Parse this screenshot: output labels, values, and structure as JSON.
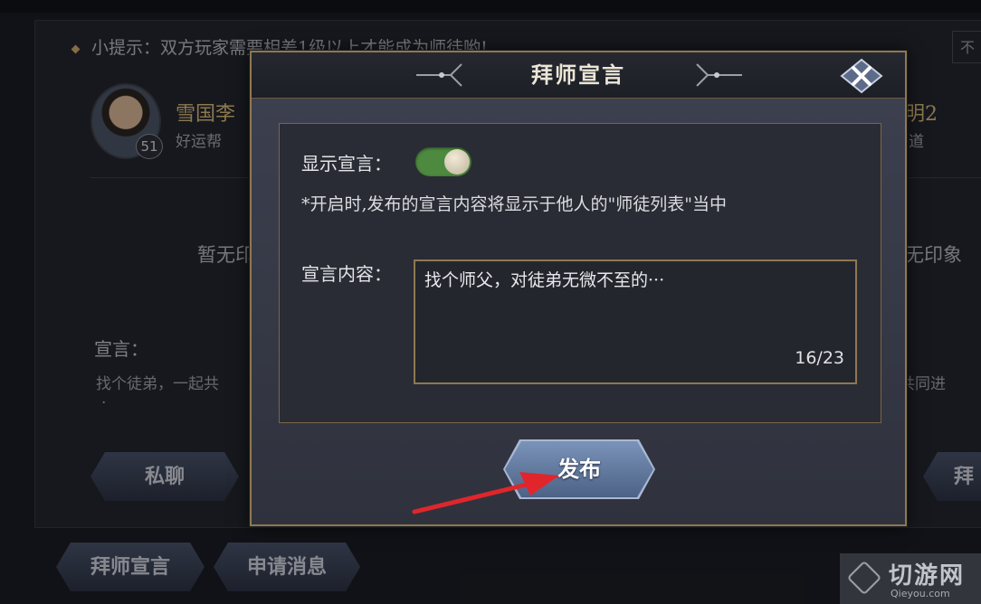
{
  "background": {
    "tip_text": "小提示：双方玩家需要相差1级以上才能成为师徒哟!",
    "tip_right_text": "不",
    "player": {
      "name": "雪国李",
      "level": "51",
      "guild": "好运帮"
    },
    "right_player": {
      "name": "明2",
      "guild": "道"
    },
    "empty_left": "暂无印",
    "empty_right": "无印象",
    "declaration_label": "宣言：",
    "declaration_text": "找个徒弟，一起共",
    "declaration_right": "共同进",
    "declaration_dot": "·",
    "buttons": {
      "private_chat": "私聊",
      "right_edge": "拜",
      "apprentice_declaration": "拜师宣言",
      "apply_messages": "申请消息"
    }
  },
  "dialog": {
    "title": "拜师宣言",
    "show_declaration_label": "显示宣言：",
    "toggle_on": true,
    "note": "*开启时,发布的宣言内容将显示于他人的\"师徒列表\"当中",
    "content_label": "宣言内容：",
    "content_value": "找个师父，对徒弟无微不至的···",
    "char_count": "16/23",
    "publish_label": "发布"
  },
  "watermark": {
    "title": "切游网",
    "sub": "Qieyou.com"
  },
  "colors": {
    "toggle_green": "#4d8a3f",
    "gold_border": "#8e7850",
    "name_gold": "#d6b979",
    "arrow_red": "#e0262b"
  }
}
